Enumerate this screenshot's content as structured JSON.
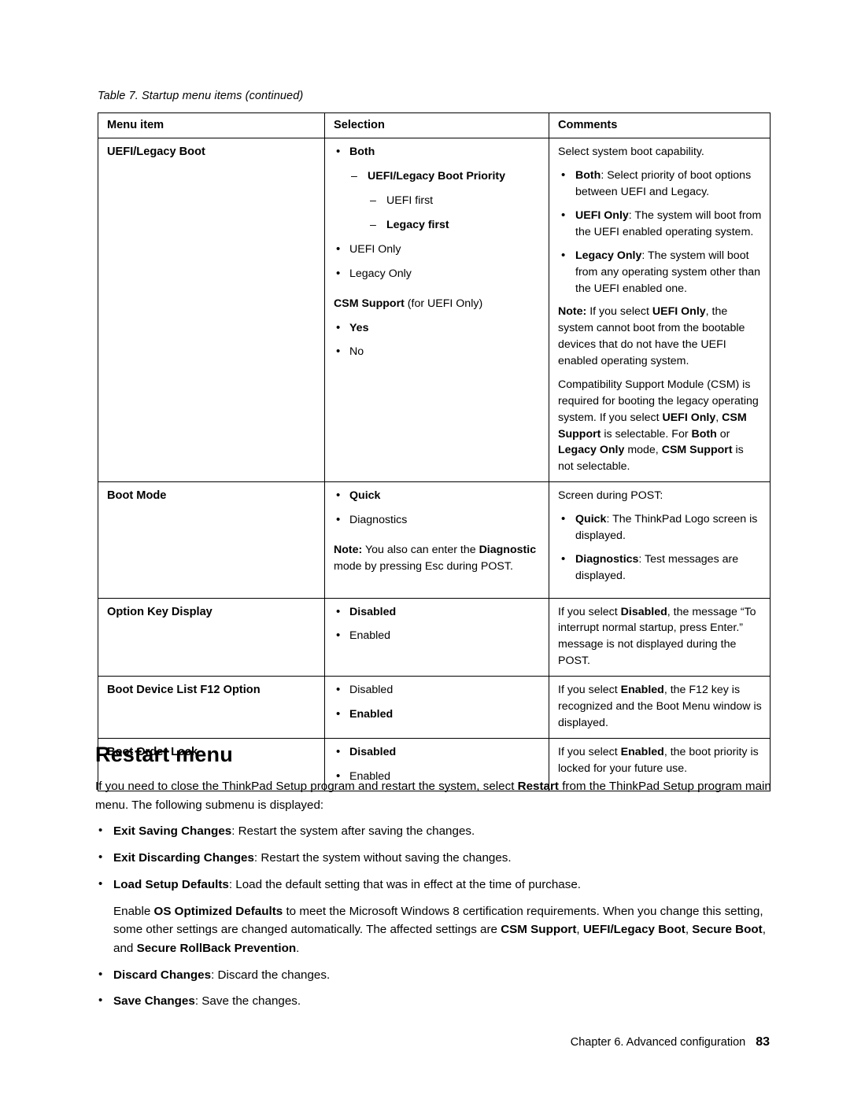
{
  "document": {
    "table_caption": "Table 7. Startup menu items (continued)",
    "section_heading": "Restart menu",
    "footer": {
      "chapter": "Chapter 6. Advanced configuration",
      "page_number": "83"
    }
  },
  "table": {
    "headers": [
      "Menu item",
      "Selection",
      "Comments"
    ],
    "rows": [
      {
        "menu_item": "UEFI/Legacy Boot",
        "selection": [
          {
            "level": 1,
            "marker": "bullet",
            "text": "Both",
            "bold": true
          },
          {
            "level": 2,
            "marker": "dash",
            "text": "UEFI/Legacy Boot Priority",
            "bold": true
          },
          {
            "level": 3,
            "marker": "dash",
            "text": "UEFI first",
            "bold": false
          },
          {
            "level": 3,
            "marker": "dash",
            "text": "Legacy first",
            "bold": true
          },
          {
            "level": 1,
            "marker": "bullet",
            "text": "UEFI Only",
            "bold": false
          },
          {
            "level": 1,
            "marker": "bullet",
            "text": "Legacy Only",
            "bold": false
          },
          {
            "level": 0,
            "marker": "none",
            "text": "CSM Support (for UEFI Only)",
            "bold": false
          },
          {
            "level": 1,
            "marker": "bullet",
            "text": "Yes",
            "bold": true
          },
          {
            "level": 1,
            "marker": "bullet",
            "text": "No",
            "bold": false
          }
        ],
        "comments": [
          "Select system boot capability.",
          "Both: Select priority of boot options between UEFI and Legacy.",
          "UEFI Only: The system will boot from the UEFI enabled operating system.",
          "Legacy Only: The system will boot from any operating system other than the UEFI enabled one.",
          "Note: If you select UEFI Only, the system cannot boot from the bootable devices that do not have the UEFI enabled operating system.",
          "Compatibility Support Module (CSM) is required for booting the legacy operating system. If you select UEFI Only, CSM Support is selectable. For Both or Legacy Only mode, CSM Support is not selectable."
        ]
      },
      {
        "menu_item": "Boot Mode",
        "selection": [
          {
            "level": 1,
            "marker": "bullet",
            "text": "Quick",
            "bold": true
          },
          {
            "level": 1,
            "marker": "bullet",
            "text": "Diagnostics",
            "bold": false
          },
          {
            "level": 0,
            "marker": "none",
            "text": "Note: You also can enter the Diagnostic mode by pressing Esc during POST.",
            "bold": false
          }
        ],
        "comments": [
          "Screen during POST:",
          "Quick: The ThinkPad Logo screen is displayed.",
          "Diagnostics: Test messages are displayed."
        ]
      },
      {
        "menu_item": "Option Key Display",
        "selection": [
          {
            "level": 1,
            "marker": "bullet",
            "text": "Disabled",
            "bold": true
          },
          {
            "level": 1,
            "marker": "bullet",
            "text": "Enabled",
            "bold": false
          }
        ],
        "comments": [
          "If you select Disabled, the message “To interrupt normal startup, press Enter.” message is not displayed during the POST."
        ]
      },
      {
        "menu_item": "Boot Device List F12 Option",
        "selection": [
          {
            "level": 1,
            "marker": "bullet",
            "text": "Disabled",
            "bold": false
          },
          {
            "level": 1,
            "marker": "bullet",
            "text": "Enabled",
            "bold": true
          }
        ],
        "comments": [
          "If you select Enabled, the F12 key is recognized and the Boot Menu window is displayed."
        ]
      },
      {
        "menu_item": "Boot Order Lock",
        "selection": [
          {
            "level": 1,
            "marker": "bullet",
            "text": "Disabled",
            "bold": true
          },
          {
            "level": 1,
            "marker": "bullet",
            "text": "Enabled",
            "bold": false
          }
        ],
        "comments": [
          "If you select Enabled, the boot priority is locked for your future use."
        ]
      }
    ]
  },
  "restart_section": {
    "intro": "If you need to close the ThinkPad Setup program and restart the system, select Restart from the ThinkPad Setup program main menu. The following submenu is displayed:",
    "items": [
      "Exit Saving Changes: Restart the system after saving the changes.",
      "Exit Discarding Changes: Restart the system without saving the changes.",
      "Load Setup Defaults: Load the default setting that was in effect at the time of purchase.",
      "Discard Changes: Discard the changes.",
      "Save Changes: Save the changes."
    ],
    "note_paragraph": "Enable OS Optimized Defaults to meet the Microsoft Windows 8 certification requirements. When you change this setting, some other settings are changed automatically. The affected settings are CSM Support, UEFI/Legacy Boot, Secure Boot, and Secure RollBack Prevention."
  }
}
